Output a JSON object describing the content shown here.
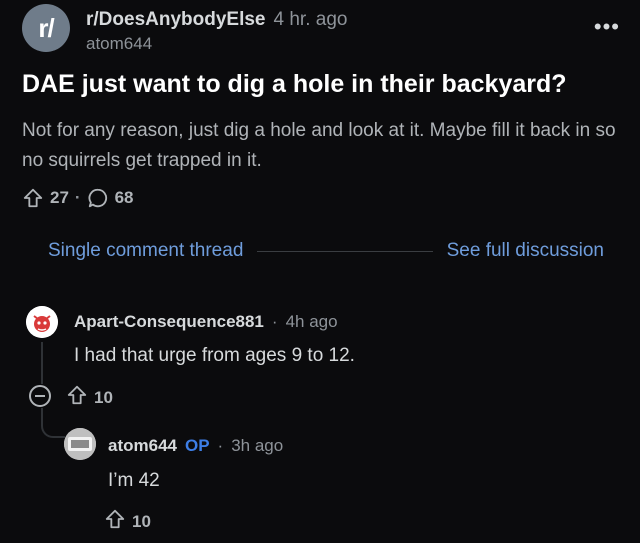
{
  "post": {
    "subreddit_icon": "r/",
    "subreddit": "r/DoesAnybodyElse",
    "age": "4 hr. ago",
    "author": "atom644",
    "more_icon": "•••",
    "title": "DAE just want to dig a hole in their backyard?",
    "body": "Not for any reason, just dig a hole and look at it. Maybe fill it back in so no squirrels get trapped in it.",
    "upvotes": "27",
    "comments": "68"
  },
  "thread_nav": {
    "single_label": "Single comment thread",
    "full_label": "See full discussion"
  },
  "comment": {
    "user": "Apart-Consequence881",
    "age": "4h ago",
    "text": "I had that urge from ages 9 to 12.",
    "upvotes": "10"
  },
  "reply": {
    "user": "atom644",
    "op_badge": "OP",
    "age": "3h ago",
    "text": "I’m 42",
    "upvotes": "10"
  },
  "icons": [
    "subreddit-avatar",
    "more-icon",
    "upvote-icon",
    "comment-bubble-icon",
    "collapse-icon",
    "avatar"
  ],
  "colors": {
    "background": "#0b0b0d",
    "link": "#6f9ddc",
    "op": "#3d7ee6",
    "muted": "#8e9399"
  }
}
